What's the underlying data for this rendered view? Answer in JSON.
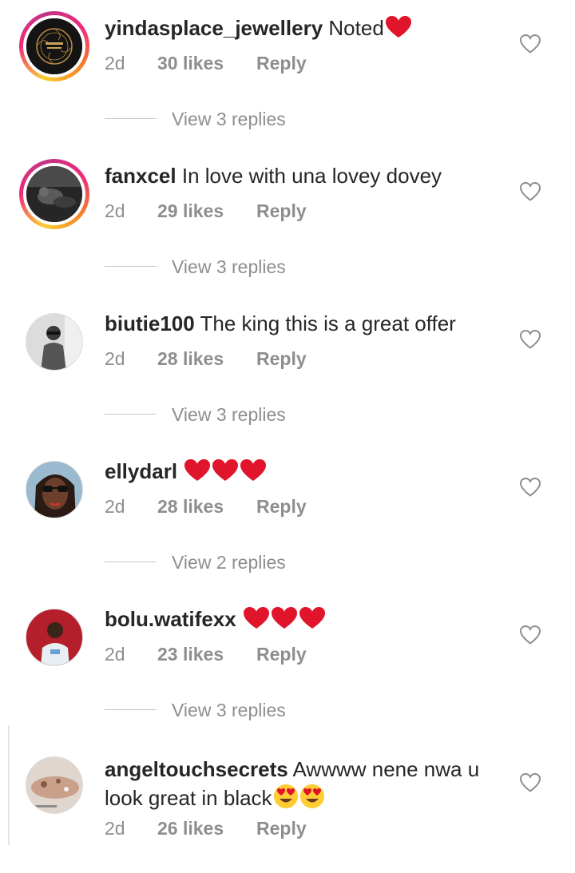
{
  "comments": [
    {
      "username": "yindasplace_jewellery",
      "text": "Noted",
      "emoji": [
        "heart"
      ],
      "time": "2d",
      "likes": "30 likes",
      "reply": "Reply",
      "view_replies": "View 3 replies",
      "avatar": "jewellery-logo-avatar",
      "story_ring": true
    },
    {
      "username": "fanxcel",
      "text": "In love with una lovey dovey",
      "emoji": [],
      "time": "2d",
      "likes": "29 likes",
      "reply": "Reply",
      "view_replies": "View 3 replies",
      "avatar": "dark-photo-avatar",
      "story_ring": true
    },
    {
      "username": "biutie100",
      "text": "The king this is a great offer",
      "emoji": [],
      "time": "2d",
      "likes": "28 likes",
      "reply": "Reply",
      "view_replies": "View 3 replies",
      "avatar": "grayscale-man-avatar",
      "story_ring": false
    },
    {
      "username": "ellydarl",
      "text": "",
      "emoji": [
        "heart",
        "heart",
        "heart"
      ],
      "time": "2d",
      "likes": "28 likes",
      "reply": "Reply",
      "view_replies": "View 2 replies",
      "avatar": "woman-sunglasses-avatar",
      "story_ring": false
    },
    {
      "username": "bolu.watifexx",
      "text": "",
      "emoji": [
        "heart",
        "heart",
        "heart"
      ],
      "time": "2d",
      "likes": "23 likes",
      "reply": "Reply",
      "view_replies": "View 3 replies",
      "avatar": "man-red-background-avatar",
      "story_ring": false
    },
    {
      "username": "angeltouchsecrets",
      "text": "Awwww nene nwa u look great in black",
      "emoji": [
        "heart-eyes",
        "heart-eyes"
      ],
      "time": "2d",
      "likes": "26 likes",
      "reply": "Reply",
      "avatar": "skin-product-avatar",
      "story_ring": false
    }
  ],
  "icons": {
    "like": "heart-outline-icon",
    "heart_emoji": "red-heart-emoji",
    "heart_eyes_emoji": "heart-eyes-emoji"
  },
  "colors": {
    "text": "#262626",
    "secondary": "#8e8e8e",
    "heart": "#e0142b",
    "emoji_face": "#ffcc33"
  }
}
